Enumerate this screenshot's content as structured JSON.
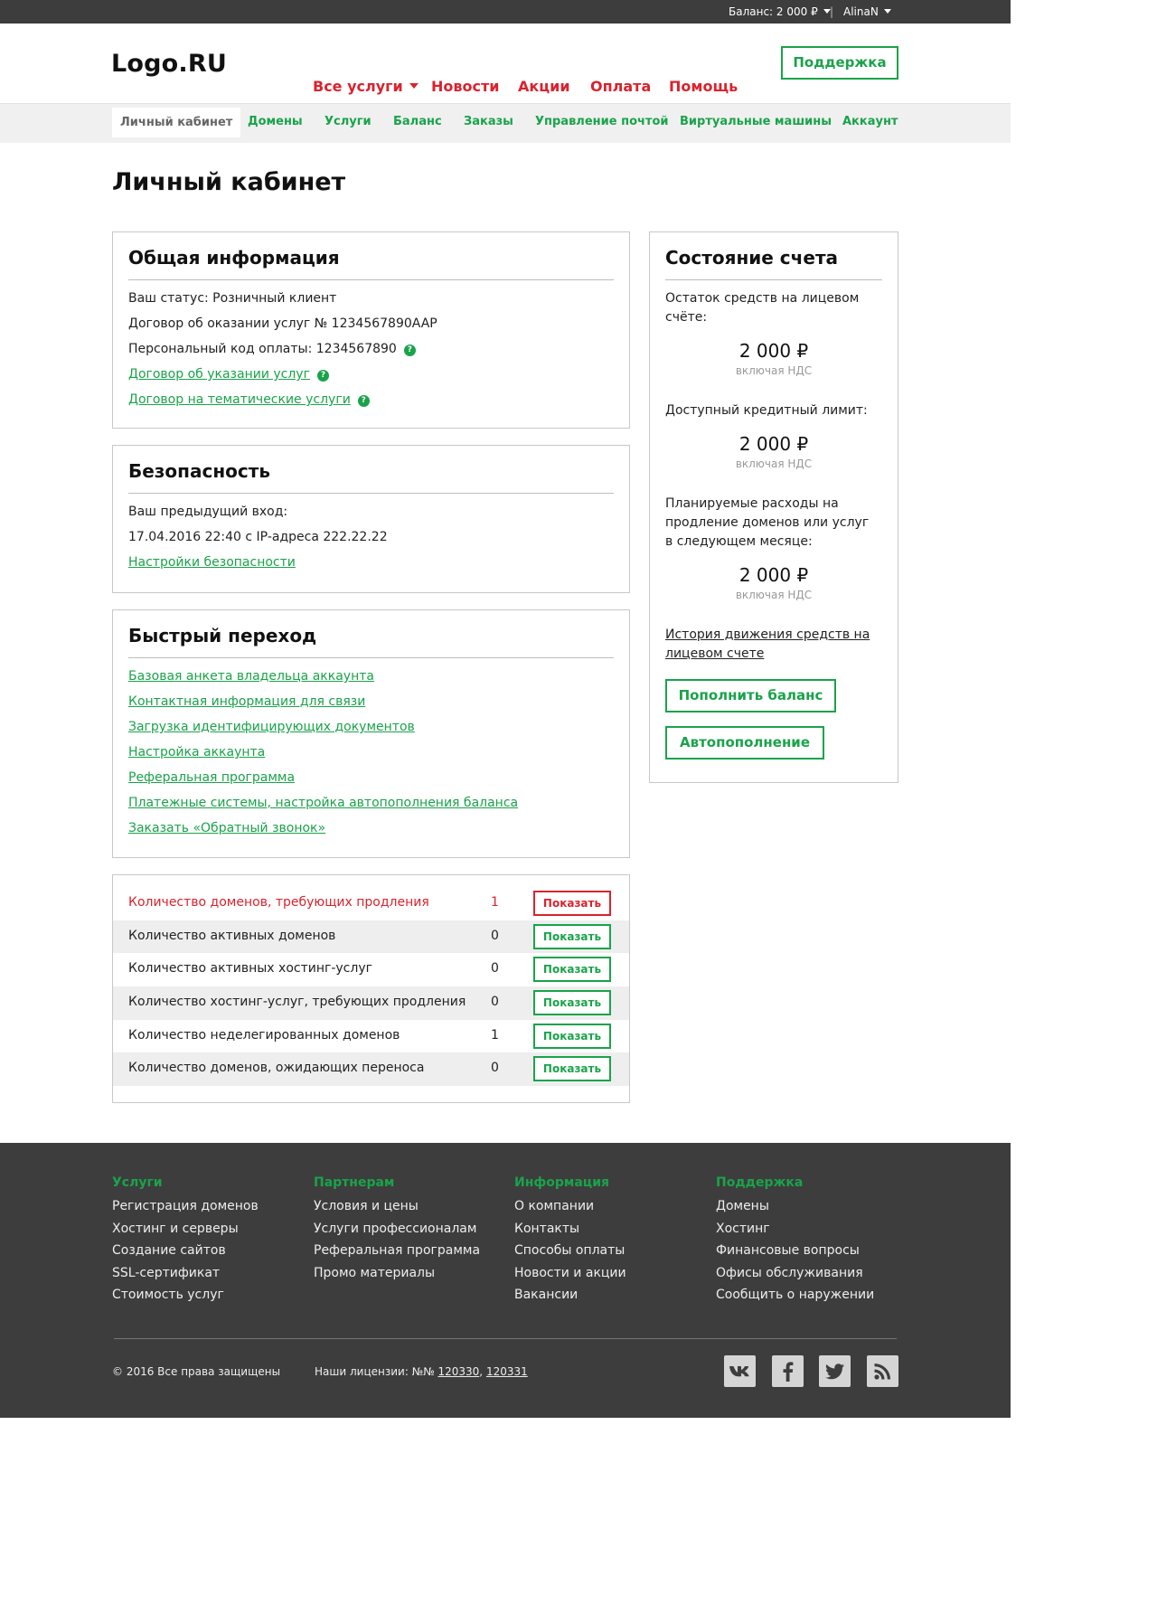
{
  "topbar": {
    "balance_label": "Баланс: 2 000 ₽",
    "separator": "|",
    "user": "AlinaN"
  },
  "header": {
    "logo": "Logo.RU",
    "nav": [
      {
        "label": "Все услуги"
      },
      {
        "label": "Новости"
      },
      {
        "label": "Акции"
      },
      {
        "label": "Оплата"
      },
      {
        "label": "Помощь"
      }
    ],
    "support_button": "Поддержка"
  },
  "subnav": {
    "items": [
      {
        "label": "Личный кабинет",
        "active": true
      },
      {
        "label": "Домены"
      },
      {
        "label": "Услуги"
      },
      {
        "label": "Баланс"
      },
      {
        "label": "Заказы"
      },
      {
        "label": "Управление почтой"
      },
      {
        "label": "Виртуальные машины"
      },
      {
        "label": "Аккаунт"
      }
    ]
  },
  "page": {
    "title": "Личный кабинет"
  },
  "general_info": {
    "title": "Общая информация",
    "status": "Ваш статус: Розничный клиент",
    "contract": "Договор об оказании услуг № 1234567890AAP",
    "payment_code": "Персональный код оплаты: 1234567890",
    "link_contract": "Договор об указании услуг",
    "link_thematic": "Договор на тематические услуги",
    "help_glyph": "?"
  },
  "security": {
    "title": "Безопасность",
    "prev_login_label": "Ваш предыдущий вход:",
    "prev_login_value": "17.04.2016 22:40 с IP-адреса 222.22.22",
    "settings_link": "Настройки безопасности"
  },
  "quick_nav": {
    "title": "Быстрый переход",
    "links": [
      "Базовая анкета владельца аккаунта",
      "Контактная информация для связи",
      "Загрузка идентифицирующих документов",
      "Настройка аккаунта",
      "Реферальная программа",
      "Платежные системы, настройка автопополнения баланса",
      "Заказать «Обратный звонок»"
    ]
  },
  "stats": {
    "rows": [
      {
        "label": "Количество доменов, требующих продления",
        "count": "1",
        "button": "Показать",
        "highlight": true
      },
      {
        "label": "Количество активных доменов",
        "count": "0",
        "button": "Показать"
      },
      {
        "label": "Количество активных хостинг-услуг",
        "count": "0",
        "button": "Показать"
      },
      {
        "label": "Количество хостинг-услуг, требующих продления",
        "count": "0",
        "button": "Показать"
      },
      {
        "label": "Количество неделегированных доменов",
        "count": "1",
        "button": "Показать"
      },
      {
        "label": "Количество доменов, ожидающих переноса",
        "count": "0",
        "button": "Показать"
      }
    ]
  },
  "account_state": {
    "title": "Состояние счета",
    "balance_label": "Остаток средств на лицевом счёте:",
    "balance_value": "2 000 ₽",
    "credit_label": "Доступный кредитный лимит:",
    "credit_value": "2 000 ₽",
    "planned_label_1": "Планируемые расходы на",
    "planned_label_2": "продление доменов или услуг",
    "planned_label_3": "в следующем месяце:",
    "planned_value": "2 000 ₽",
    "vat_note": "включая НДС",
    "history_link_1": "История движения средств на",
    "history_link_2": "лицевом счете",
    "topup_button": "Пополнить баланс",
    "autopay_button": "Автопополнение"
  },
  "footer": {
    "columns": [
      {
        "title": "Услуги",
        "links": [
          "Регистрация доменов",
          "Хостинг и серверы",
          "Создание сайтов",
          "SSL-сертификат",
          "Стоимость услуг"
        ]
      },
      {
        "title": "Партнерам",
        "links": [
          "Условия и цены",
          "Услуги профессионалам",
          "Реферальная программа",
          "Промо материалы"
        ]
      },
      {
        "title": "Информация",
        "links": [
          "О компании",
          "Контакты",
          "Способы оплаты",
          "Новости и акции",
          "Вакансии"
        ]
      },
      {
        "title": "Поддержка",
        "links": [
          "Домены",
          "Хостинг",
          "Финансовые вопросы",
          "Офисы обслуживания",
          "Сообщить о наружении"
        ]
      }
    ],
    "copyright": "© 2016 Все права защищены",
    "licenses_label": "Наши лицензии: №№",
    "license_1": "120330",
    "license_sep": ",",
    "license_2": "120331",
    "social": [
      "vk-icon",
      "facebook-icon",
      "twitter-icon",
      "rss-icon"
    ]
  },
  "colors": {
    "accent_green": "#1aa34a",
    "accent_red": "#d9232e",
    "dark_bg": "#3d3d3d"
  }
}
